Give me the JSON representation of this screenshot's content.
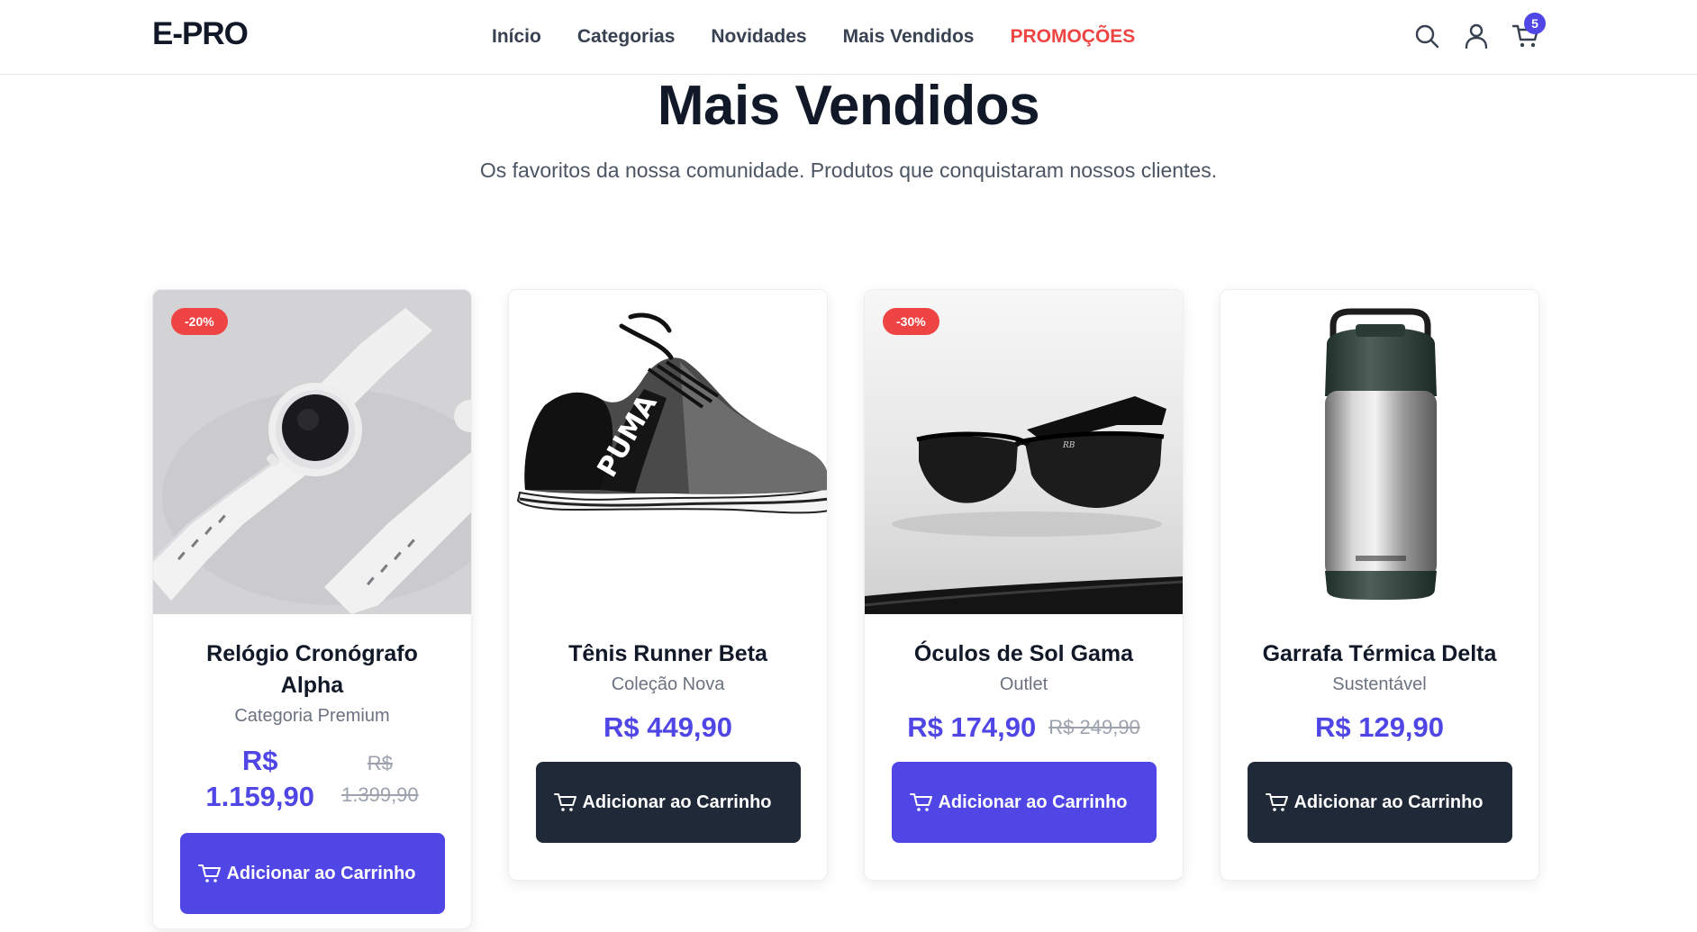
{
  "header": {
    "logo": "E-PRO",
    "nav": [
      "Início",
      "Categorias",
      "Novidades",
      "Mais Vendidos",
      "PROMOÇÕES"
    ],
    "icons": [
      "search-icon",
      "user-icon",
      "cart-icon"
    ],
    "cart_count": "5"
  },
  "hero": {
    "title": "Mais Vendidos",
    "subtitle": "Os favoritos da nossa comunidade. Produtos que conquistaram nossos clientes."
  },
  "colors": {
    "accent": "#4f46e5",
    "promo": "#ef4444",
    "dark": "#1f2937"
  },
  "products": [
    {
      "badge": "-20%",
      "name": "Relógio Cronógrafo Alpha",
      "category": "Categoria Premium",
      "price_line1": "R$",
      "price_line2": "1.159,90",
      "old_price_line1": "R$",
      "old_price_line2": "1.399,90",
      "button": "Adicionar ao Carrinho"
    },
    {
      "badge": "",
      "name": "Tênis Runner Beta",
      "category": "Coleção Nova",
      "price": "R$ 449,90",
      "old_price": "",
      "button": "Adicionar ao Carrinho"
    },
    {
      "badge": "-30%",
      "name": "Óculos de Sol Gama",
      "category": "Outlet",
      "price": "R$ 174,90",
      "old_price": "R$ 249,90",
      "button": "Adicionar ao Carrinho"
    },
    {
      "badge": "",
      "name": "Garrafa Térmica Delta",
      "category": "Sustentável",
      "price": "R$ 129,90",
      "old_price": "",
      "button": "Adicionar ao Carrinho"
    }
  ]
}
